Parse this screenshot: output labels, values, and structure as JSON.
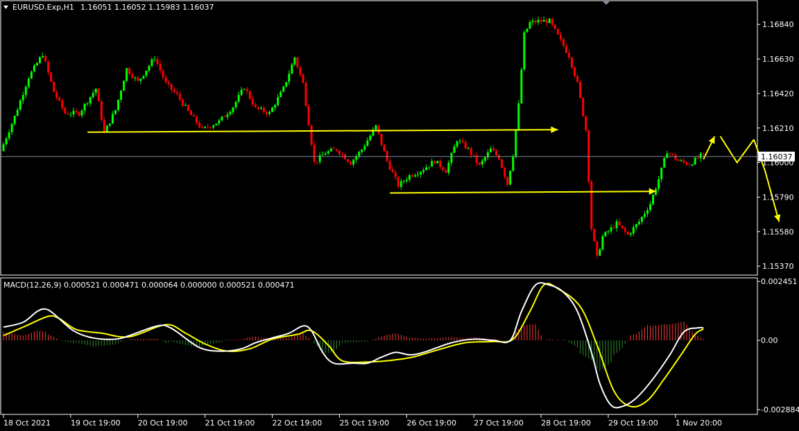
{
  "header": {
    "symbol": "EURUSD.Exp,H1",
    "ohlc": "1.16051 1.16052 1.15983 1.16037"
  },
  "macd_header": "MACD(12,26,9) 0.000521 0.000471 0.000064 0.000000 0.000521 0.000471",
  "colors": {
    "background": "#000000",
    "frame": "#ffffff",
    "bull": "#00ff00",
    "bear": "#ff0000",
    "arrow": "#ffff00",
    "macd_line": "#ffffff",
    "signal_line": "#ffff00",
    "hist_pos": "#ff3b3b",
    "hist_neg": "#2f8f2f",
    "price_line": "#7f8c9a"
  },
  "chart_data": [
    {
      "type": "candlestick",
      "symbol": "EURUSD.Exp,H1",
      "current_price": 1.16037,
      "current_price_label": "1.16037",
      "ylim": [
        1.1532,
        1.1698
      ],
      "y_ticks": [
        {
          "v": 1.1684,
          "label": "1.16840"
        },
        {
          "v": 1.1663,
          "label": "1.16630"
        },
        {
          "v": 1.1642,
          "label": "1.16420"
        },
        {
          "v": 1.1621,
          "label": "1.16210"
        },
        {
          "v": 1.16,
          "label": "1.16000"
        },
        {
          "v": 1.1579,
          "label": "1.15790"
        },
        {
          "v": 1.1558,
          "label": "1.15580"
        },
        {
          "v": 1.1537,
          "label": "1.15370"
        }
      ],
      "x_labels": [
        {
          "i": 0,
          "label": "18 Oct 2021"
        },
        {
          "i": 24,
          "label": "19 Oct 19:00"
        },
        {
          "i": 48,
          "label": "20 Oct 19:00"
        },
        {
          "i": 72,
          "label": "21 Oct 19:00"
        },
        {
          "i": 96,
          "label": "22 Oct 19:00"
        },
        {
          "i": 120,
          "label": "25 Oct 19:00"
        },
        {
          "i": 144,
          "label": "26 Oct 19:00"
        },
        {
          "i": 168,
          "label": "27 Oct 19:00"
        },
        {
          "i": 192,
          "label": "28 Oct 19:00"
        },
        {
          "i": 216,
          "label": "29 Oct 19:00"
        },
        {
          "i": 240,
          "label": "1 Nov 20:00"
        }
      ],
      "bar_count_visible": 270,
      "price_path": [
        [
          0,
          1.1607
        ],
        [
          5,
          1.1628
        ],
        [
          10,
          1.1652
        ],
        [
          15,
          1.1666
        ],
        [
          19,
          1.1643
        ],
        [
          23,
          1.163
        ],
        [
          28,
          1.163
        ],
        [
          34,
          1.1645
        ],
        [
          37,
          1.1618
        ],
        [
          41,
          1.1632
        ],
        [
          45,
          1.1657
        ],
        [
          49,
          1.1649
        ],
        [
          55,
          1.1664
        ],
        [
          59,
          1.1648
        ],
        [
          63,
          1.1641
        ],
        [
          67,
          1.1631
        ],
        [
          72,
          1.162
        ],
        [
          78,
          1.1625
        ],
        [
          83,
          1.1634
        ],
        [
          87,
          1.1646
        ],
        [
          91,
          1.1633
        ],
        [
          96,
          1.163
        ],
        [
          101,
          1.1645
        ],
        [
          105,
          1.1664
        ],
        [
          108,
          1.1648
        ],
        [
          112,
          1.16
        ],
        [
          116,
          1.1606
        ],
        [
          120,
          1.1608
        ],
        [
          125,
          1.16
        ],
        [
          129,
          1.1608
        ],
        [
          134,
          1.1622
        ],
        [
          138,
          1.1601
        ],
        [
          142,
          1.1586
        ],
        [
          146,
          1.1592
        ],
        [
          150,
          1.1595
        ],
        [
          155,
          1.1601
        ],
        [
          159,
          1.1595
        ],
        [
          163,
          1.1614
        ],
        [
          167,
          1.1608
        ],
        [
          171,
          1.1598
        ],
        [
          175,
          1.1608
        ],
        [
          178,
          1.1603
        ],
        [
          181,
          1.1587
        ],
        [
          183,
          1.1605
        ],
        [
          185,
          1.1635
        ],
        [
          187,
          1.1678
        ],
        [
          189,
          1.1685
        ],
        [
          192,
          1.1686
        ],
        [
          196,
          1.1686
        ],
        [
          200,
          1.1674
        ],
        [
          203,
          1.1665
        ],
        [
          206,
          1.1648
        ],
        [
          209,
          1.162
        ],
        [
          211,
          1.156
        ],
        [
          213,
          1.1542
        ],
        [
          215,
          1.1555
        ],
        [
          220,
          1.1563
        ],
        [
          224,
          1.1556
        ],
        [
          228,
          1.1564
        ],
        [
          232,
          1.1575
        ],
        [
          235,
          1.159
        ],
        [
          238,
          1.1607
        ],
        [
          242,
          1.1601
        ],
        [
          246,
          1.1599
        ],
        [
          250,
          1.1604
        ]
      ],
      "arrows": [
        {
          "points": [
            [
              30,
              1.16185
            ],
            [
              198,
              1.162
            ]
          ],
          "head": true
        },
        {
          "points": [
            [
              138,
              1.15815
            ],
            [
              233,
              1.15825
            ]
          ],
          "head": true
        },
        {
          "points": [
            [
              250,
              1.1602
            ],
            [
              254,
              1.1616
            ]
          ],
          "head": true
        },
        {
          "points": [
            [
              256,
              1.1616
            ],
            [
              262,
              1.16
            ],
            [
              268,
              1.1614
            ]
          ],
          "head": false
        },
        {
          "points": [
            [
              268,
              1.1614
            ],
            [
              272,
              1.1595
            ],
            [
              277,
              1.1564
            ]
          ],
          "head": true
        }
      ]
    },
    {
      "type": "macd",
      "params": "MACD(12,26,9)",
      "ylim": [
        -0.00305,
        0.00257
      ],
      "y_ticks": [
        {
          "v": 0.002451,
          "label": "0.002451"
        },
        {
          "v": 0.0,
          "label": "0.00"
        },
        {
          "v": -0.002884,
          "label": "-0.002884"
        }
      ],
      "macd_path": [
        [
          0,
          0.00055
        ],
        [
          7,
          0.00075
        ],
        [
          12,
          0.0012
        ],
        [
          15,
          0.0013
        ],
        [
          18,
          0.0011
        ],
        [
          25,
          0.0004
        ],
        [
          32,
          0.0001
        ],
        [
          40,
          5e-05
        ],
        [
          45,
          0.0002
        ],
        [
          55,
          0.0006
        ],
        [
          60,
          0.0005
        ],
        [
          70,
          -0.0003
        ],
        [
          78,
          -0.00045
        ],
        [
          85,
          -0.00035
        ],
        [
          90,
          -0.0001
        ],
        [
          96,
          0.0001
        ],
        [
          102,
          0.0003
        ],
        [
          107,
          0.0006
        ],
        [
          110,
          0.0004
        ],
        [
          114,
          -0.0005
        ],
        [
          118,
          -0.00095
        ],
        [
          125,
          -0.00095
        ],
        [
          130,
          -0.00095
        ],
        [
          135,
          -0.0007
        ],
        [
          140,
          -0.0005
        ],
        [
          145,
          -0.0006
        ],
        [
          150,
          -0.0005
        ],
        [
          160,
          -0.0001
        ],
        [
          168,
          5e-05
        ],
        [
          175,
          0.0
        ],
        [
          181,
          0.0
        ],
        [
          185,
          0.0012
        ],
        [
          190,
          0.0023
        ],
        [
          195,
          0.0023
        ],
        [
          200,
          0.002
        ],
        [
          205,
          0.0012
        ],
        [
          210,
          -0.0005
        ],
        [
          213,
          -0.0018
        ],
        [
          217,
          -0.0027
        ],
        [
          221,
          -0.00275
        ],
        [
          226,
          -0.0024
        ],
        [
          232,
          -0.0016
        ],
        [
          238,
          -0.0006
        ],
        [
          243,
          0.00035
        ],
        [
          248,
          0.00052
        ],
        [
          250,
          0.00052
        ]
      ],
      "signal_path": [
        [
          0,
          0.0002
        ],
        [
          8,
          0.0006
        ],
        [
          16,
          0.001
        ],
        [
          20,
          0.0009
        ],
        [
          26,
          0.00045
        ],
        [
          35,
          0.0003
        ],
        [
          45,
          0.00015
        ],
        [
          58,
          0.00065
        ],
        [
          65,
          0.0003
        ],
        [
          72,
          -0.00015
        ],
        [
          80,
          -0.00045
        ],
        [
          88,
          -0.00035
        ],
        [
          96,
          5e-05
        ],
        [
          105,
          0.00025
        ],
        [
          110,
          0.0004
        ],
        [
          116,
          -0.0002
        ],
        [
          121,
          -0.00085
        ],
        [
          130,
          -0.0009
        ],
        [
          137,
          -0.00085
        ],
        [
          146,
          -0.0007
        ],
        [
          155,
          -0.0004
        ],
        [
          165,
          -0.0001
        ],
        [
          175,
          -5e-05
        ],
        [
          182,
          5e-05
        ],
        [
          188,
          0.0012
        ],
        [
          193,
          0.0023
        ],
        [
          198,
          0.00215
        ],
        [
          206,
          0.0014
        ],
        [
          212,
          -0.0002
        ],
        [
          218,
          -0.0021
        ],
        [
          224,
          -0.00275
        ],
        [
          230,
          -0.0025
        ],
        [
          236,
          -0.0016
        ],
        [
          242,
          -0.0006
        ],
        [
          247,
          0.00025
        ],
        [
          250,
          0.00047
        ]
      ]
    }
  ]
}
